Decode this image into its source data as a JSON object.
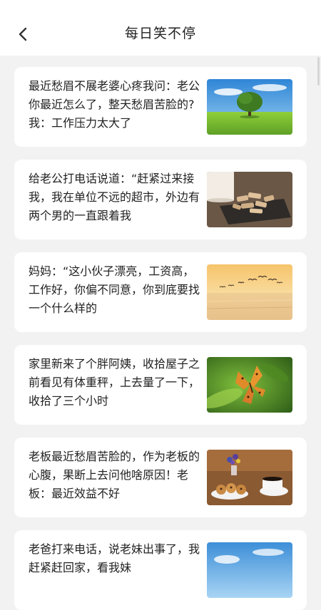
{
  "header": {
    "title": "每日笑不停",
    "back_icon": "chevron-left-icon"
  },
  "items": [
    {
      "text": "最近愁眉不展老婆心疼我问：老公你最近怎么了，整天愁眉苦脸的?我：工作压力太大了",
      "image": "tree-meadow"
    },
    {
      "text": "给老公打电话说道：“赶紧过来接我，我在单位不远的超市，外边有两个男的一直跟着我",
      "image": "cookies-on-slate"
    },
    {
      "text": "妈妈：“这小伙子漂亮，工资高，工作好，你偏不同意，你到底要找一个什么样的",
      "image": "birds-over-sea-sunset"
    },
    {
      "text": "家里新来了个胖阿姨，收拾屋子之前看见有体重秤，上去量了一下，收拾了三个小时",
      "image": "butterfly-on-leaf"
    },
    {
      "text": "老板最近愁眉苦脸的，作为老板的心腹，果断上去问他啥原因！老板：最近效益不好",
      "image": "coffee-and-cookies"
    },
    {
      "text": "老爸打来电话，说老妹出事了，我赶紧赶回家，看我妹",
      "image": "blue-sky"
    }
  ]
}
